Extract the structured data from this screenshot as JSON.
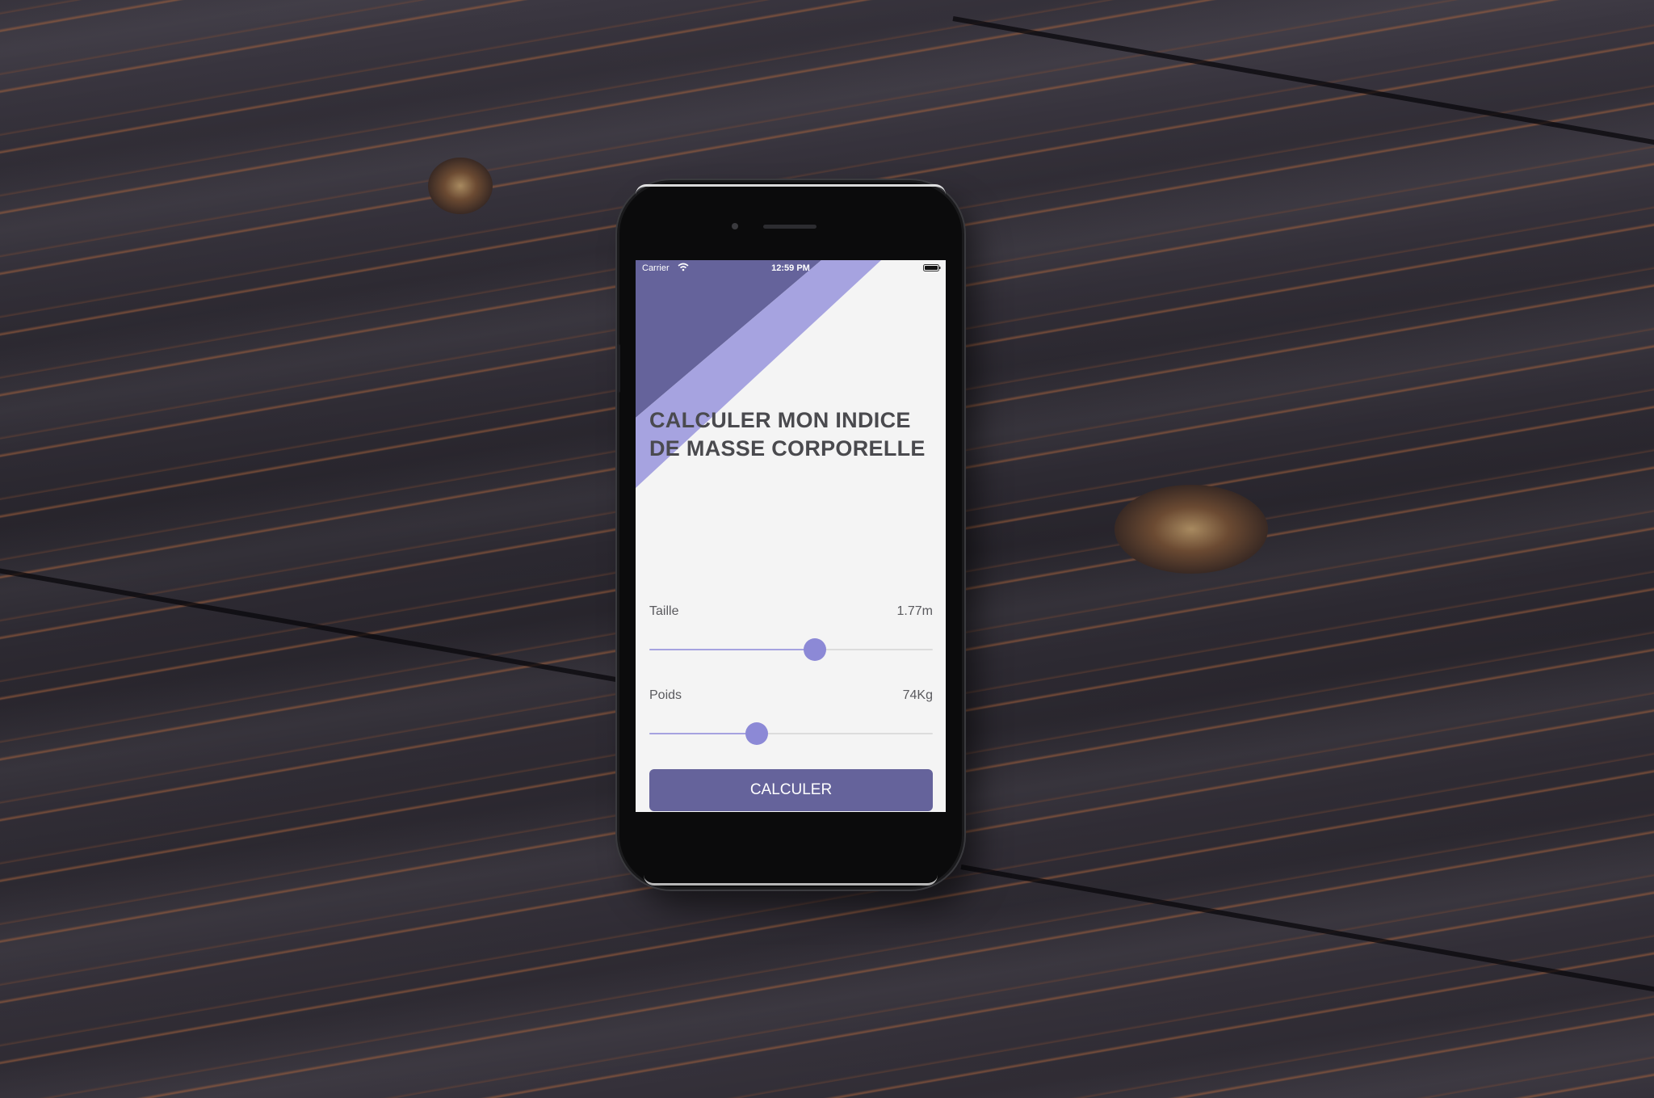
{
  "status_bar": {
    "carrier": "Carrier",
    "time": "12:59 PM",
    "wifi_icon": "wifi-icon",
    "battery_icon": "battery-icon"
  },
  "screen": {
    "title": "CALCULER MON INDICE DE MASSE CORPORELLE"
  },
  "height_slider": {
    "label": "Taille",
    "value_text": "1.77m",
    "fraction": 0.585
  },
  "weight_slider": {
    "label": "Poids",
    "value_text": "74Kg",
    "fraction": 0.38
  },
  "button": {
    "label": "CALCULER"
  },
  "colors": {
    "primary": "#65639b",
    "accent": "#a6a3e0",
    "thumb": "#8c89d6",
    "background": "#f4f4f4",
    "text": "#4a4a4e"
  }
}
